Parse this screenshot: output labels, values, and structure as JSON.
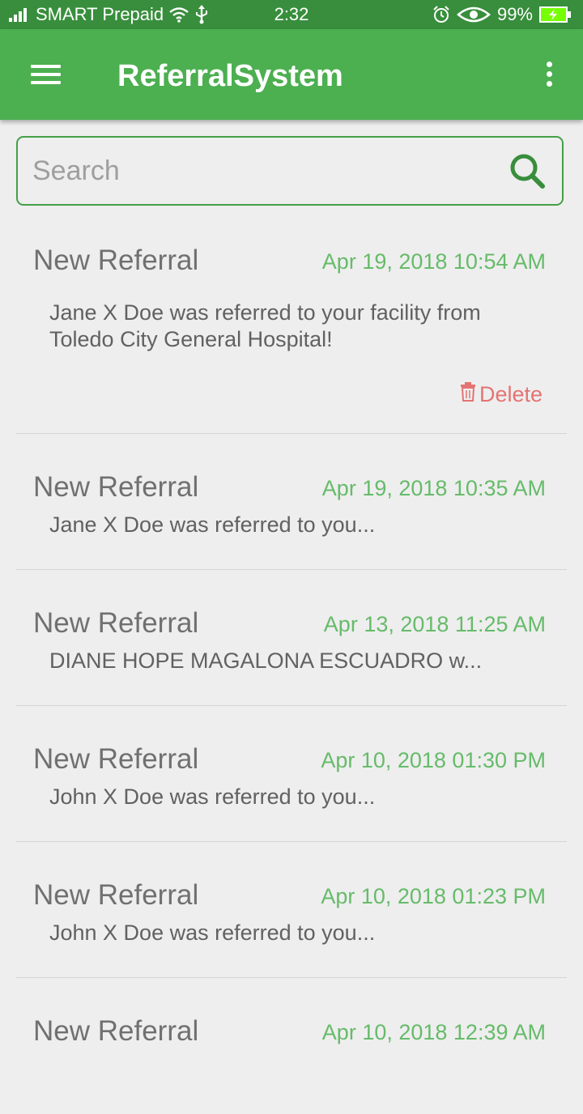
{
  "status_bar": {
    "carrier": "SMART Prepaid",
    "time": "2:32",
    "battery": "99%",
    "icons": [
      "signal-icon",
      "wifi-icon",
      "usb-icon",
      "alarm-icon",
      "eye-icon",
      "battery-charging-icon"
    ]
  },
  "app_bar": {
    "title": "ReferralSystem",
    "icons": [
      "menu-icon",
      "more-vert-icon"
    ]
  },
  "search": {
    "placeholder": "Search",
    "value": "",
    "icon": "search-icon"
  },
  "colors": {
    "status_bar": "#388e3c",
    "app_bar": "#4caf50",
    "accent": "#43a047",
    "date_text": "#66bb6a",
    "delete_text": "#e57373",
    "background": "#eeeeee"
  },
  "referrals": [
    {
      "title": "New Referral",
      "date": "Apr 19, 2018 10:54 AM",
      "message": "Jane X Doe was referred to your facility from Toledo City General Hospital!",
      "expanded": true,
      "delete_label": "Delete",
      "delete_icon": "trash-icon"
    },
    {
      "title": "New Referral",
      "date": "Apr 19, 2018 10:35 AM",
      "message": "Jane X Doe was referred to you..."
    },
    {
      "title": "New Referral",
      "date": "Apr 13, 2018 11:25 AM",
      "message": "DIANE HOPE MAGALONA ESCUADRO w..."
    },
    {
      "title": "New Referral",
      "date": "Apr 10, 2018 01:30 PM",
      "message": "John X Doe was referred to you..."
    },
    {
      "title": "New Referral",
      "date": "Apr 10, 2018 01:23 PM",
      "message": "John X Doe was referred to you..."
    },
    {
      "title": "New Referral",
      "date": "Apr 10, 2018 12:39 AM",
      "message": ""
    }
  ]
}
